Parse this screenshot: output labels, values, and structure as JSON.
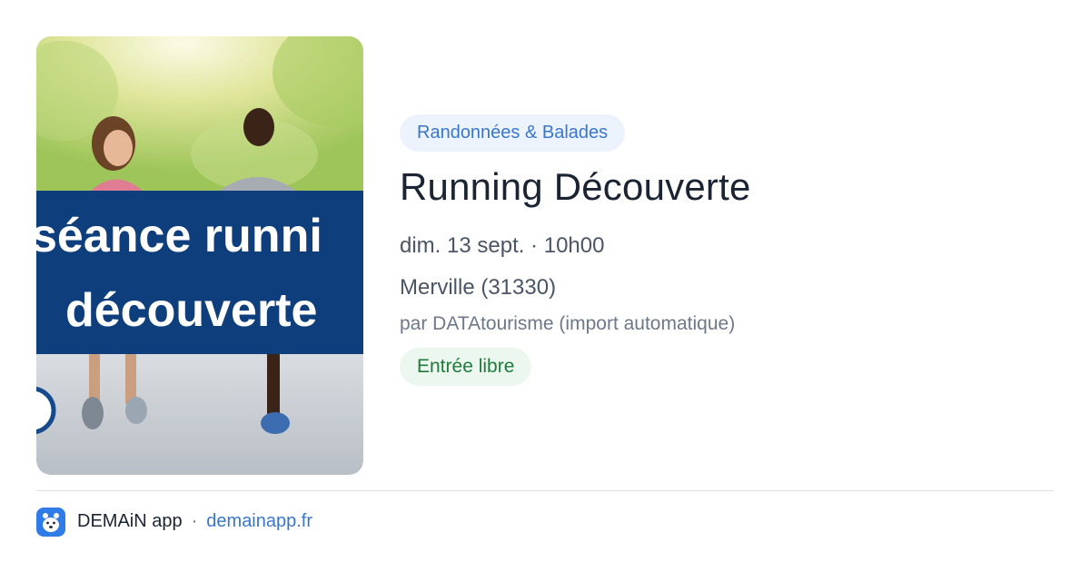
{
  "image": {
    "banner_line1": "séance runni",
    "banner_line2": "découverte"
  },
  "event": {
    "category": "Randonnées & Balades",
    "title": "Running Découverte",
    "datetime": "dim. 13 sept. · 10h00",
    "location": "Merville (31330)",
    "source": "par DATAtourisme (import automatique)",
    "price": "Entrée libre"
  },
  "footer": {
    "app_name": "DEMAiN app",
    "separator": "·",
    "link": "demainapp.fr"
  },
  "colors": {
    "category_bg": "#edf3fd",
    "category_text": "#3a77c9",
    "price_bg": "#ecf8ef",
    "price_text": "#1f7a3c",
    "banner_blue": "#0e3f7c",
    "logo_blue": "#2f7be8"
  }
}
